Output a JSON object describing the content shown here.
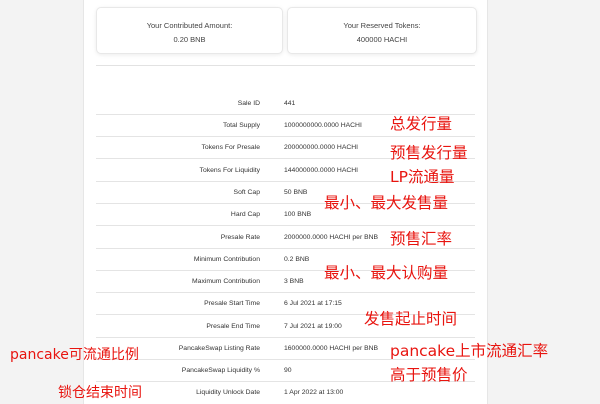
{
  "cards": {
    "contributed": {
      "title": "Your Contributed Amount:",
      "value": "0.20 BNB"
    },
    "reserved": {
      "title": "Your Reserved Tokens:",
      "value": "400000 HACHI"
    }
  },
  "rows": [
    {
      "label": "Sale ID",
      "value": "441"
    },
    {
      "label": "Total Supply",
      "value": "1000000000.0000 HACHI"
    },
    {
      "label": "Tokens For Presale",
      "value": "200000000.0000 HACHI"
    },
    {
      "label": "Tokens For Liquidity",
      "value": "144000000.0000 HACHI"
    },
    {
      "label": "Soft Cap",
      "value": "50 BNB"
    },
    {
      "label": "Hard Cap",
      "value": "100 BNB"
    },
    {
      "label": "Presale Rate",
      "value": "2000000.0000 HACHI per BNB"
    },
    {
      "label": "Minimum Contribution",
      "value": "0.2 BNB"
    },
    {
      "label": "Maximum Contribution",
      "value": "3 BNB"
    },
    {
      "label": "Presale Start Time",
      "value": "6 Jul 2021 at 17:15"
    },
    {
      "label": "Presale End Time",
      "value": "7 Jul 2021 at 19:00"
    },
    {
      "label": "PancakeSwap Listing Rate",
      "value": "1600000.0000 HACHI per BNB"
    },
    {
      "label": "PancakeSwap Liquidity %",
      "value": "90"
    },
    {
      "label": "Liquidity Unlock Date",
      "value": "1 Apr 2022 at 13:00"
    }
  ],
  "annotations": {
    "total_supply": "总发行量",
    "presale_supply": "预售发行量",
    "lp_supply": "LP流通量",
    "caps": "最小、最大发售量",
    "presale_rate": "预售汇率",
    "contribution": "最小、最大认购量",
    "sale_time": "发售起止时间",
    "listing_rate": "pancake上市流通汇率",
    "listing_rate_note": "高于预售价",
    "liquidity_pct": "pancake可流通比例",
    "unlock": "锁仓结束时间"
  }
}
